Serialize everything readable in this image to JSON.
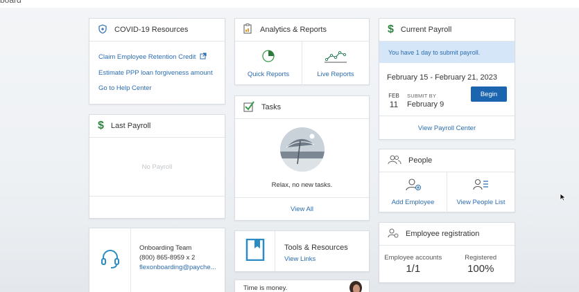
{
  "top_strip_text": "board",
  "covid": {
    "title": "COVID-19 Resources",
    "links": [
      "Claim Employee Retention Credit",
      "Estimate PPP loan forgiveness amount",
      "Go to Help Center"
    ]
  },
  "last_payroll": {
    "title": "Last Payroll",
    "empty_text": "No Payroll"
  },
  "onboarding": {
    "team": "Onboarding Team",
    "phone": "(800) 865-8959 x 2",
    "email": "flexonboarding@payche..."
  },
  "analytics": {
    "title": "Analytics & Reports",
    "quick": "Quick Reports",
    "live": "Live Reports"
  },
  "tasks": {
    "title": "Tasks",
    "empty_text": "Relax, no new tasks.",
    "view_all": "View All"
  },
  "tools": {
    "title": "Tools & Resources",
    "link": "View Links"
  },
  "money": {
    "text": "Time is money."
  },
  "current_payroll": {
    "title": "Current Payroll",
    "alert": "You have 1 day to submit payroll.",
    "range": "February 15 - February 21, 2023",
    "date_month": "FEB",
    "date_day": "11",
    "submit_label": "SUBMIT BY",
    "submit_value": "February 9",
    "begin": "Begin",
    "view_center": "View Payroll Center"
  },
  "people": {
    "title": "People",
    "add": "Add Employee",
    "list": "View People List"
  },
  "registration": {
    "title": "Employee registration",
    "accounts_label": "Employee accounts",
    "accounts_value": "1/1",
    "registered_label": "Registered",
    "registered_value": "100%"
  },
  "colors": {
    "accent": "#2b6cb0",
    "button": "#1a64b0",
    "alert_bg": "#d4e6f8",
    "dollar": "#2e8540"
  }
}
